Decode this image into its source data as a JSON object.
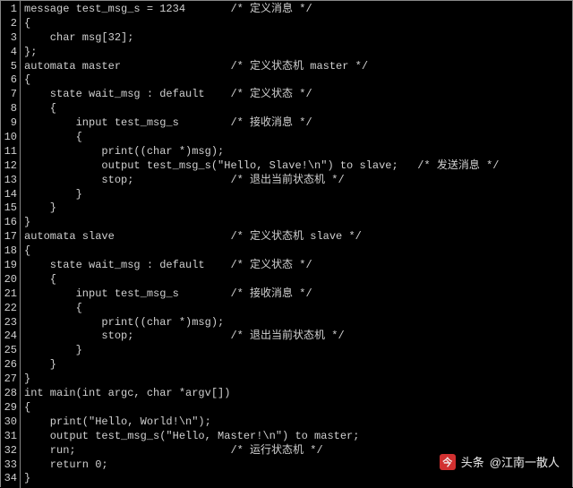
{
  "code_lines": [
    "message test_msg_s = 1234       /* 定义消息 */",
    "{",
    "    char msg[32];",
    "};",
    "automata master                 /* 定义状态机 master */",
    "{",
    "    state wait_msg : default    /* 定义状态 */",
    "    {",
    "        input test_msg_s        /* 接收消息 */",
    "        {",
    "            print((char *)msg);",
    "            output test_msg_s(\"Hello, Slave!\\n\") to slave;   /* 发送消息 */",
    "            stop;               /* 退出当前状态机 */",
    "        }",
    "    }",
    "}",
    "automata slave                  /* 定义状态机 slave */",
    "{",
    "    state wait_msg : default    /* 定义状态 */",
    "    {",
    "        input test_msg_s        /* 接收消息 */",
    "        {",
    "            print((char *)msg);",
    "            stop;               /* 退出当前状态机 */",
    "        }",
    "    }",
    "}",
    "int main(int argc, char *argv[])",
    "{",
    "    print(\"Hello, World!\\n\");",
    "    output test_msg_s(\"Hello, Master!\\n\") to master;",
    "    run;                        /* 运行状态机 */",
    "    return 0;",
    "}"
  ],
  "watermark": {
    "brand": "头条",
    "handle": "@江南一散人"
  }
}
